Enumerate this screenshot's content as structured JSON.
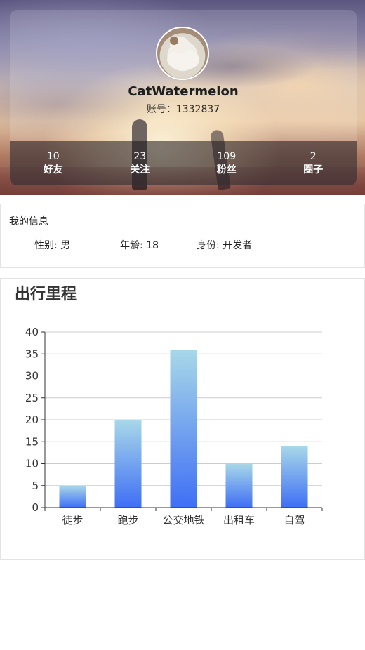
{
  "profile": {
    "username": "CatWatermelon",
    "account_label": "账号：",
    "account_id": "1332837",
    "avatar_icon": "cat-avatar"
  },
  "stats": [
    {
      "count": "10",
      "label": "好友"
    },
    {
      "count": "23",
      "label": "关注"
    },
    {
      "count": "109",
      "label": "粉丝"
    },
    {
      "count": "2",
      "label": "圈子"
    }
  ],
  "info": {
    "title": "我的信息",
    "gender": "性别: 男",
    "age": "年龄: 18",
    "role": "身份: 开发者"
  },
  "chart_title": "出行里程",
  "colors": {
    "bar_top": "#a8d8e8",
    "bar_bottom": "#3f6ff5",
    "grid": "#cccccc",
    "axis": "#333333"
  },
  "chart_data": {
    "type": "bar",
    "title": "出行里程",
    "categories": [
      "徒步",
      "跑步",
      "公交地铁",
      "出租车",
      "自驾"
    ],
    "values": [
      5,
      20,
      36,
      10,
      14
    ],
    "xlabel": "",
    "ylabel": "",
    "ylim": [
      0,
      40
    ],
    "yticks": [
      0,
      5,
      10,
      15,
      20,
      25,
      30,
      35,
      40
    ],
    "grid": true,
    "legend": "none"
  }
}
